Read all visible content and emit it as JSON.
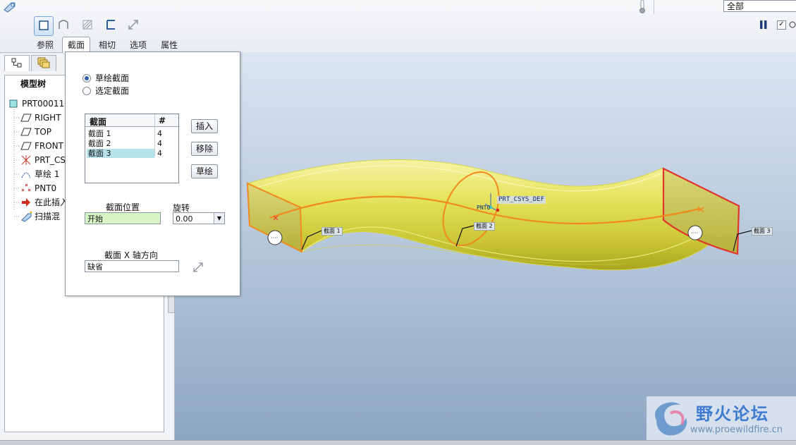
{
  "dashboard": {
    "tabs": [
      {
        "label": "参照",
        "active": false
      },
      {
        "label": "截面",
        "active": true
      },
      {
        "label": "相切",
        "active": false
      },
      {
        "label": "选项",
        "active": false
      },
      {
        "label": "属性",
        "active": false
      }
    ],
    "filter": "全部",
    "preview_checked": true
  },
  "model_tree": {
    "title": "模型树",
    "items": [
      {
        "label": "PRT00011.",
        "icon": "part-icon"
      },
      {
        "label": "RIGHT",
        "icon": "datum-plane-icon"
      },
      {
        "label": "TOP",
        "icon": "datum-plane-icon"
      },
      {
        "label": "FRONT",
        "icon": "datum-plane-icon"
      },
      {
        "label": "PRT_CS",
        "icon": "csys-icon"
      },
      {
        "label": "草绘 1",
        "icon": "sketch-icon"
      },
      {
        "label": "PNT0",
        "icon": "datum-point-icon"
      },
      {
        "label": "在此插入",
        "icon": "insert-here-icon"
      },
      {
        "label": "扫描混",
        "icon": "sweep-blend-icon"
      }
    ]
  },
  "sections_panel": {
    "radio_options": [
      {
        "label": "草绘截面",
        "selected": true
      },
      {
        "label": "选定截面",
        "selected": false
      }
    ],
    "table": {
      "headers": [
        "截面",
        "#"
      ],
      "rows": [
        {
          "name": "截面 1",
          "count": "4",
          "selected": false
        },
        {
          "name": "截面 2",
          "count": "4",
          "selected": false
        },
        {
          "name": "截面 3",
          "count": "4",
          "selected": true
        }
      ]
    },
    "buttons": {
      "insert": "插入",
      "remove": "移除",
      "sketch": "草绘"
    },
    "section_location": {
      "label": "截面位置",
      "value": "开始"
    },
    "rotation": {
      "label": "旋转",
      "value": "0.00"
    },
    "x_axis": {
      "label": "截面 X 轴方向",
      "value": "缺省"
    }
  },
  "viewport": {
    "section_labels": [
      "截面 1",
      "截面 2",
      "截面 3"
    ],
    "csys_label": "PRT_CSYS_DEF",
    "point_label": "PNT0"
  },
  "watermark": {
    "title": "野火论坛",
    "url": "www.proewildfire.cn"
  },
  "colors": {
    "surface": "#e3e05a",
    "section_orange": "#f08a1c",
    "section_red": "#e2352c",
    "background_top": "#dbe6f1",
    "background_bottom": "#8ea6c2"
  }
}
